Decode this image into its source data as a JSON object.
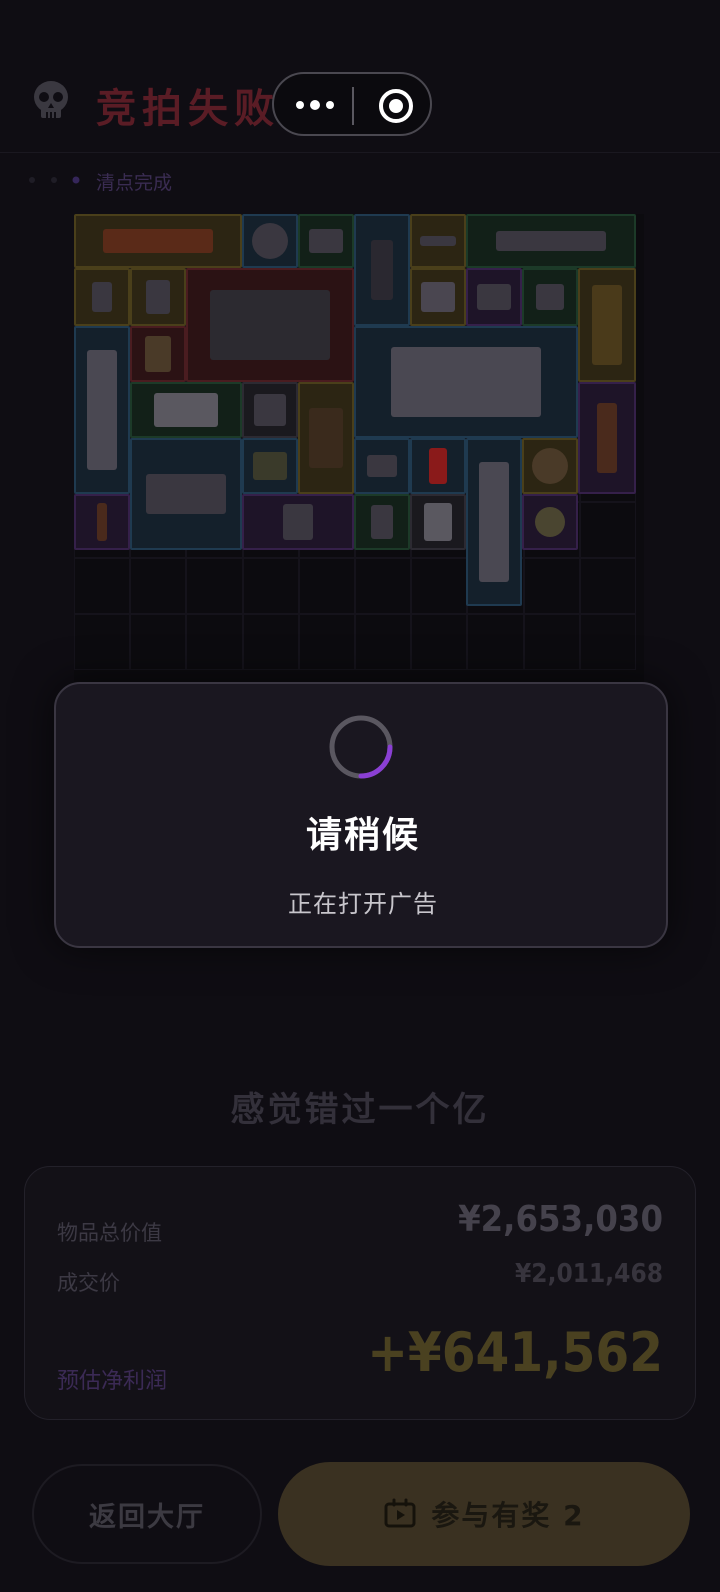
{
  "header": {
    "title": "竞拍失败",
    "status_text": "清点完成"
  },
  "modal": {
    "title": "请稍候",
    "subtitle": "正在打开广告"
  },
  "result": {
    "tagline": "感觉错过一个亿",
    "total_value_label": "物品总价值",
    "total_value": "¥2,653,030",
    "deal_price_label": "成交价",
    "deal_price": "¥2,011,468",
    "profit_label": "预估净利润",
    "profit": "+¥641,562"
  },
  "buttons": {
    "back_label": "返回大厅",
    "join_label": "参与有奖 2"
  },
  "colors": {
    "background": "#0f0d13",
    "spinner_accent": "#8a3fd4",
    "profit_gold": "#4a4120"
  },
  "icons": [
    "skull-icon",
    "more-icon",
    "target-icon",
    "loading-spinner",
    "tv-icon"
  ]
}
